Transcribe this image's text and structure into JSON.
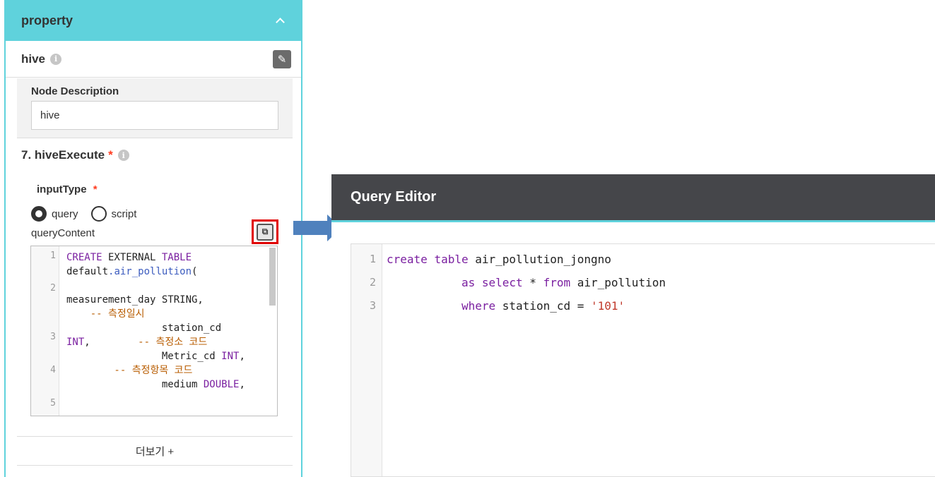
{
  "property_panel": {
    "title": "property",
    "node": {
      "name": "hive",
      "description_label": "Node Description",
      "description_value": "hive"
    },
    "section": {
      "title": "7. hiveExecute",
      "required_mark": "*",
      "input_type_label": "inputType",
      "input_type_required": "*",
      "options": [
        {
          "label": "query",
          "selected": true
        },
        {
          "label": "script",
          "selected": false
        }
      ],
      "query_content_label": "queryContent",
      "code_line_numbers": [
        "1",
        "2",
        "3",
        "4",
        "5"
      ],
      "code": [
        {
          "kw": "CREATE",
          "t1": " EXTERNAL ",
          "kw2": "TABLE"
        },
        {
          "t1": "default",
          "fn": ".air_pollution",
          "t2": "("
        },
        {
          "t1": ""
        },
        {
          "t1": "measurement_day STRING,"
        },
        {
          "cm": "    -- 측정일시"
        },
        {
          "t1": "                station_cd"
        },
        {
          "kw": "INT",
          "t1": ",",
          "cm": "        -- 측정소 코드"
        },
        {
          "t1": "                Metric_cd ",
          "kw": "INT",
          "t2": ","
        },
        {
          "cm": "        -- 측정항목 코드"
        },
        {
          "t1": "                medium ",
          "kw": "DOUBLE",
          "t2": ","
        }
      ]
    },
    "more_label": "더보기 +"
  },
  "query_editor": {
    "title": "Query Editor",
    "line_numbers": [
      "1",
      "2",
      "3"
    ],
    "lines": [
      {
        "kw1": "create",
        "t1": " ",
        "kw2": "table",
        "t2": " air_pollution_jongno"
      },
      {
        "indent": "           ",
        "kw1": "as",
        "t1": " ",
        "kw2": "select",
        "t2": " * ",
        "kw3": "from",
        "t3": " air_pollution"
      },
      {
        "indent": "           ",
        "kw1": "where",
        "t1": " station_cd = ",
        "str": "'101'"
      }
    ]
  },
  "colors": {
    "accent": "#5fd2dc",
    "editor_header": "#45464a",
    "keyword": "#7a1fa0",
    "comment": "#b85c00",
    "string": "#c0392b",
    "arrow": "#4f81bd",
    "highlight_box": "#e10000"
  },
  "icons": [
    "chevron-up-icon",
    "info-icon",
    "edit-icon",
    "open-editor-icon",
    "arrow-right-icon"
  ]
}
